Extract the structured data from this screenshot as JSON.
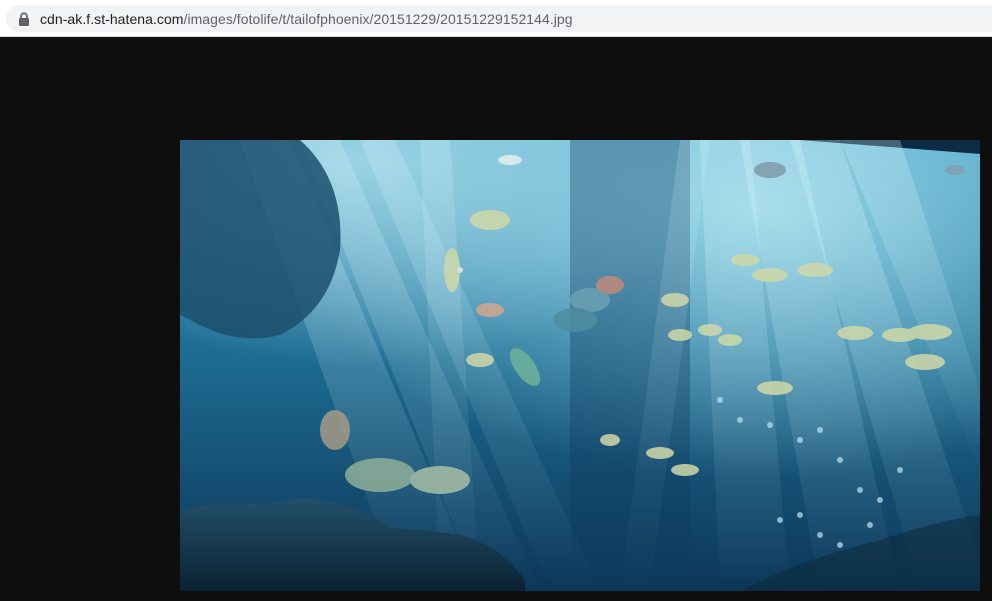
{
  "browser": {
    "url_host": "cdn-ak.f.st-hatena.com",
    "url_path": "/images/fotolife/t/tailofphoenix/20151229/20151229152144.jpg",
    "lock_icon": "lock-icon"
  },
  "page": {
    "background_color": "#0e0e0e",
    "image": {
      "icon": "aquarium-photo"
    }
  },
  "colors": {
    "water_light": "#5fb6d6",
    "water_mid": "#1f6f95",
    "water_deep": "#0c3658",
    "rock": "#0f2c3d"
  }
}
